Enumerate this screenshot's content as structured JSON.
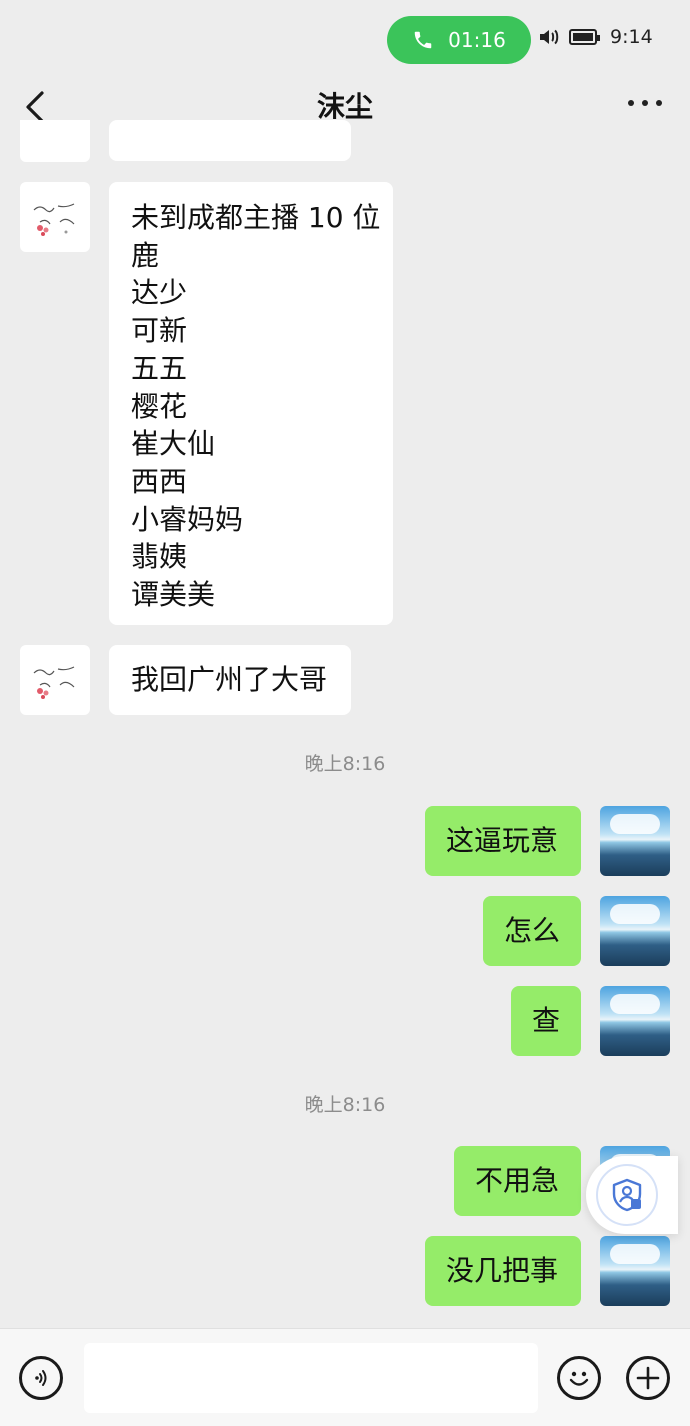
{
  "status_bar": {
    "call_timer": "01:16",
    "time": "9:14",
    "call_color": "#3bc45a"
  },
  "header": {
    "title": "沫尘",
    "back_icon": "chevron-left-icon",
    "more_icon": "more-dots-icon"
  },
  "messages": {
    "m1_lines": [
      "未到成都主播 10 位",
      "鹿",
      "达少",
      "可新",
      "五五",
      "樱花",
      "崔大仙",
      "西西",
      "小睿妈妈",
      "翡姨",
      "谭美美"
    ],
    "m1": {
      "l0": "未到成都主播 10 位",
      "l1": "鹿",
      "l2": "达少",
      "l3": "可新",
      "l4": "五五",
      "l5": "樱花",
      "l6": "崔大仙",
      "l7": "西西",
      "l8": "小睿妈妈",
      "l9": "翡姨",
      "l10": "谭美美"
    },
    "m2": "我回广州了大哥",
    "ts1": "晚上8:16",
    "m3": "这逼玩意",
    "m4": "怎么",
    "m5": "查",
    "ts2": "晚上8:16",
    "m6": "不用急",
    "m7": "没几把事"
  },
  "bottom": {
    "voice_icon": "voice-icon",
    "emoji_icon": "emoji-icon",
    "plus_icon": "plus-icon",
    "input_value": ""
  },
  "colors": {
    "background": "#ededed",
    "my_bubble": "#95ec69",
    "their_bubble": "#ffffff"
  }
}
